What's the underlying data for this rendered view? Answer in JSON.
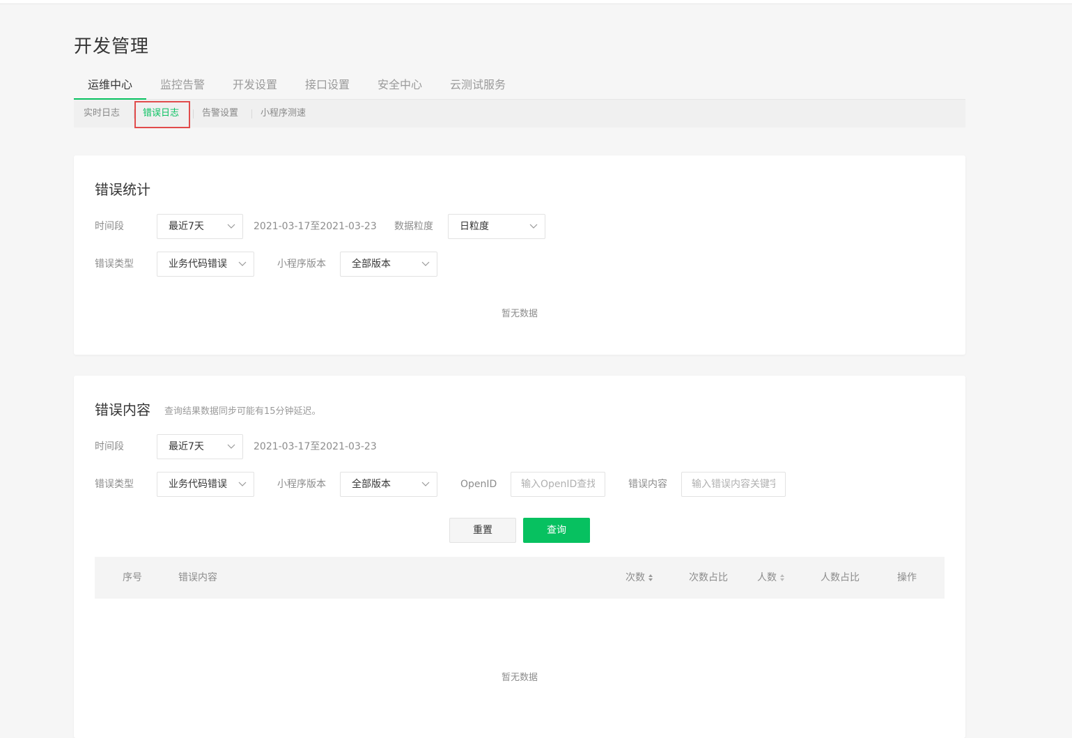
{
  "page": {
    "title": "开发管理"
  },
  "main_tabs": [
    "运维中心",
    "监控告警",
    "开发设置",
    "接口设置",
    "安全中心",
    "云测试服务"
  ],
  "sub_tabs": [
    "实时日志",
    "错误日志",
    "告警设置",
    "小程序测速"
  ],
  "stats": {
    "title": "错误统计",
    "period_label": "时间段",
    "period_value": "最近7天",
    "date_range": "2021-03-17至2021-03-23",
    "granularity_label": "数据粒度",
    "granularity_value": "日粒度",
    "error_type_label": "错误类型",
    "error_type_value": "业务代码错误",
    "version_label": "小程序版本",
    "version_value": "全部版本",
    "empty_text": "暂无数据"
  },
  "content": {
    "title": "错误内容",
    "note": "查询结果数据同步可能有15分钟延迟。",
    "period_label": "时间段",
    "period_value": "最近7天",
    "date_range": "2021-03-17至2021-03-23",
    "error_type_label": "错误类型",
    "error_type_value": "业务代码错误",
    "version_label": "小程序版本",
    "version_value": "全部版本",
    "openid_label": "OpenID",
    "openid_placeholder": "输入OpenID查找",
    "keyword_label": "错误内容",
    "keyword_placeholder": "输入错误内容关键字",
    "reset_label": "重置",
    "query_label": "查询",
    "table_headers": {
      "index": "序号",
      "content": "错误内容",
      "count": "次数",
      "count_ratio": "次数占比",
      "users": "人数",
      "users_ratio": "人数占比",
      "action": "操作"
    },
    "empty_text": "暂无数据"
  },
  "colors": {
    "accent": "#07c160",
    "highlight": "#e14b4b"
  },
  "icons": {
    "dropdown": "chevron-down-icon",
    "sort": "sort-icon"
  }
}
